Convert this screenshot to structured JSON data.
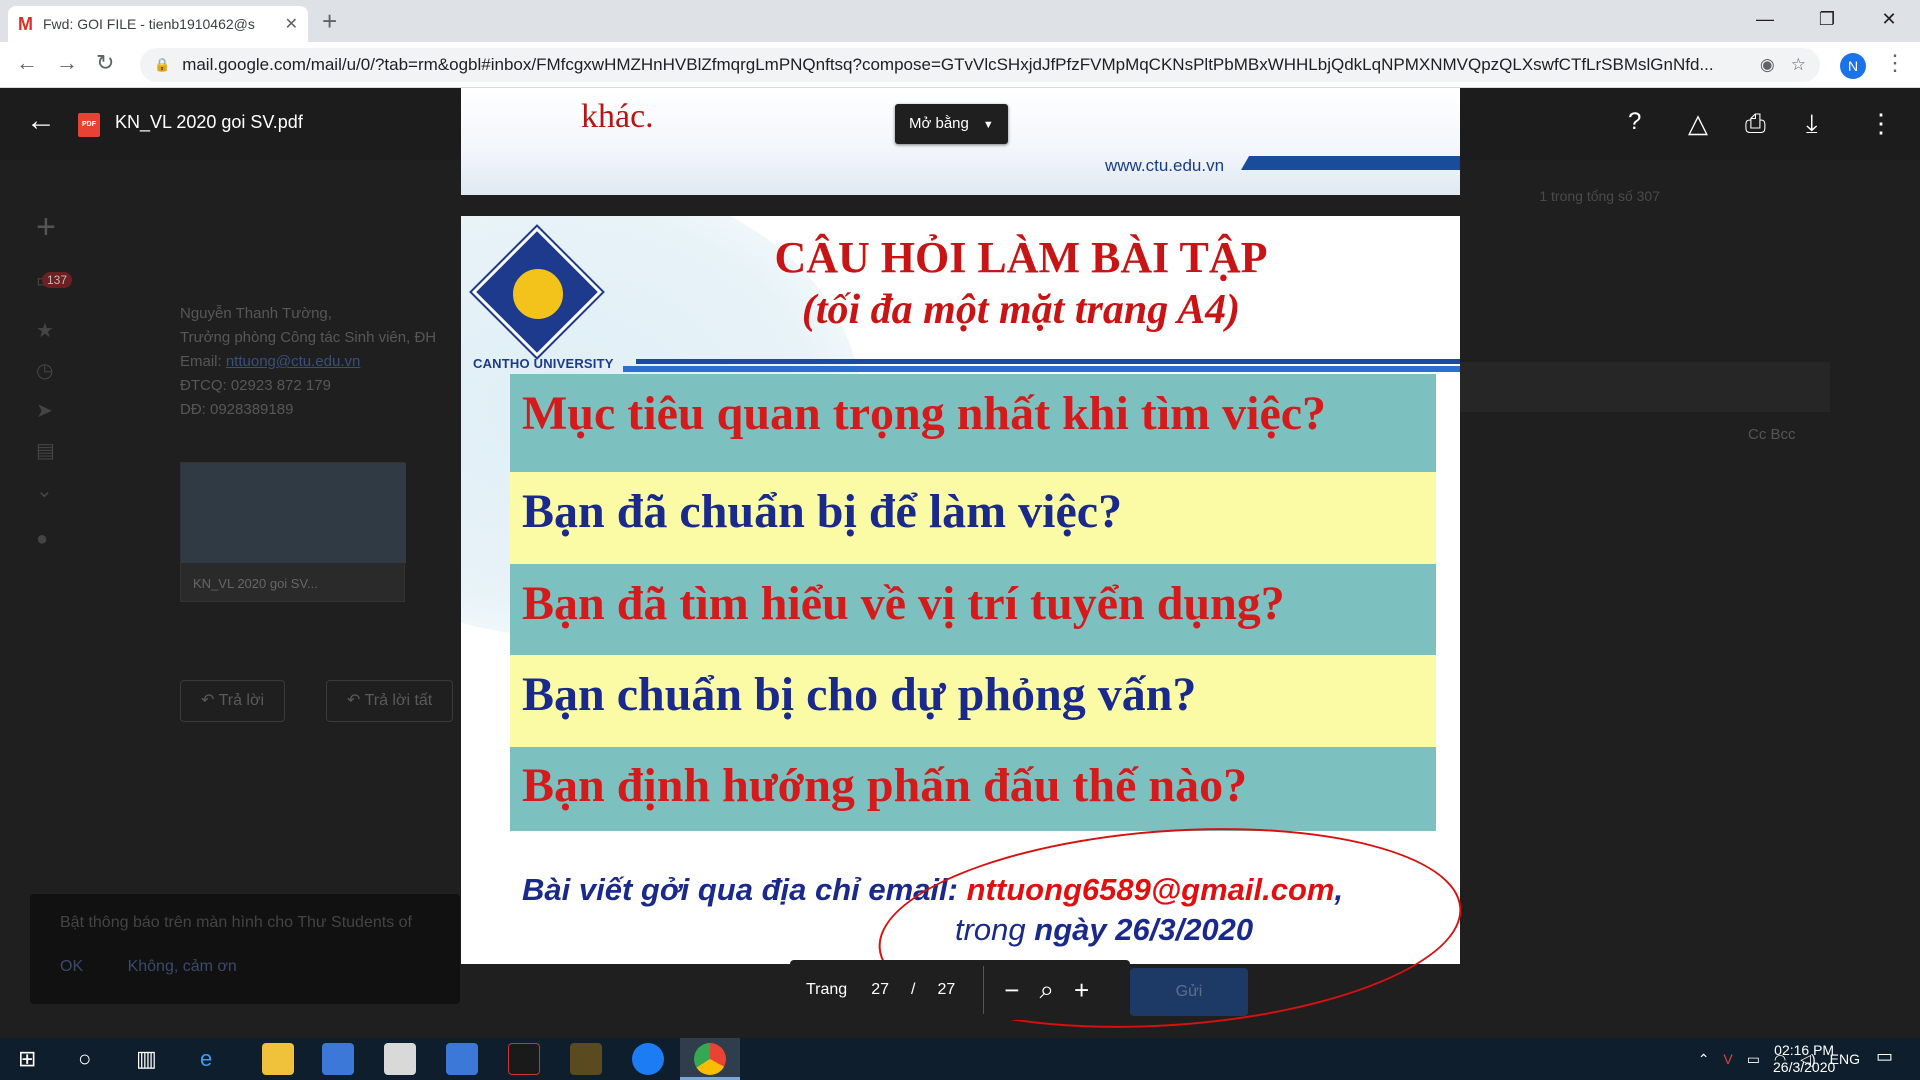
{
  "browser": {
    "tab_title": "Fwd: GOI FILE - tienb1910462@s",
    "url": "mail.google.com/mail/u/0/?tab=rm&ogbl#inbox/FMfcgxwHMZHnHVBlZfmqrgLmPNQnftsq?compose=GTvVlcSHxjdJfPfzFVMpMqCKNsPltPbMBxWHHLbjQdkLqNPMXNMVQpzQLXswfCTfLrSBMslGnNfd...",
    "profile_initial": "N"
  },
  "gmail_bg": {
    "sig_name": "Nguyễn Thanh Tường,",
    "sig_role": "Trưởng phòng Công tác Sinh viên, ĐH",
    "sig_email_label": "Email: ",
    "sig_email": "nttuong@ctu.edu.vn",
    "sig_phone1": "ĐTCQ: 02923 872 179",
    "sig_phone2": "DĐ: 0928389189",
    "attachment_name": "KN_VL 2020 goi SV...",
    "reply": "Trả lời",
    "reply_all": "Trả lời tất",
    "counter": "1 trong tổng số 307",
    "inbox_badge": "137",
    "notif_text": "Bật thông báo trên màn hình cho Thư Students of",
    "notif_ok": "OK",
    "notif_no": "Không, cảm ơn",
    "cc_bcc": "Cc Bcc",
    "send": "Gửi"
  },
  "viewer": {
    "file_name": "KN_VL 2020 goi SV.pdf",
    "open_with": "Mở bằng",
    "prev_page_text_line2": "khác.",
    "prev_page_site": "www.ctu.edu.vn",
    "page_label": "Trang",
    "current_page": "27",
    "page_sep": "/",
    "total_pages": "27"
  },
  "slide": {
    "logo_caption": "CANTHO UNIVERSITY",
    "title": "CÂU HỎI LÀM BÀI TẬP",
    "subtitle": "(tối đa một mặt trang A4)",
    "questions": [
      "Mục tiêu quan trọng nhất khi tìm việc?",
      "Bạn đã chuẩn bị để làm việc?",
      "Bạn đã tìm hiểu về vị trí tuyển dụng?",
      "Bạn chuẩn bị cho dự phỏng vấn?",
      "Bạn định hướng phấn đấu thế nào?"
    ],
    "footer_prefix": "Bài viết gởi qua địa chỉ email: ",
    "footer_email": "nttuong6589@gmail.com",
    "footer_comma": ",",
    "footer_trong": "trong ",
    "footer_date": "ngày 26/3/2020"
  },
  "taskbar": {
    "lang": "ENG",
    "time": "02:16 PM",
    "date": "26/3/2020"
  }
}
